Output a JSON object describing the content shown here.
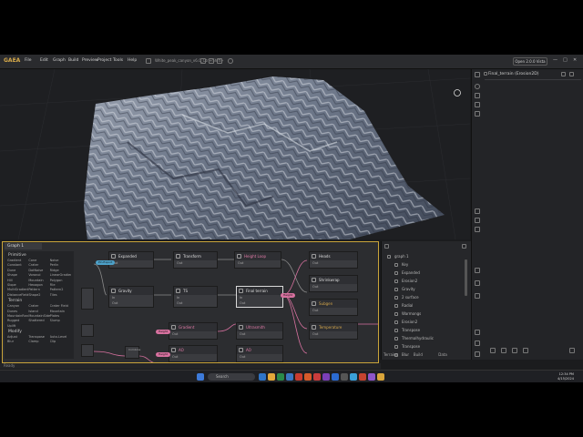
{
  "app": {
    "logo": "GAEA",
    "file_title": "White_peak_canyon_v6.0_Ctrl+Shift+",
    "open_button": "Open 2.0.0 Vista",
    "window_controls": [
      "—",
      "□",
      "✕"
    ]
  },
  "menu": [
    "File",
    "Edit",
    "Graph",
    "Build",
    "Preview",
    "Project",
    "Tools",
    "Help"
  ],
  "right_panel": {
    "title": "Final_terrain (Erosion2D)"
  },
  "graph": {
    "tab_label": "Graph 1",
    "palette": [
      {
        "title": "Primitive",
        "items": [
          "Gradient",
          "Cone",
          "Noise",
          "Constant",
          "Crater",
          "Perlin",
          "Dune",
          "DotNoise",
          "Ridge",
          "Shape",
          "Voronoi",
          "LinearGradient",
          "Hill",
          "Mountain",
          "Polygon",
          "Slope",
          "Hexagon",
          "File",
          "MultiGradient",
          "Pattern",
          "Pattern2",
          "DistanceField",
          "Shape2",
          "Tiles"
        ]
      },
      {
        "title": "Terrain",
        "items": [
          "Canyon",
          "Crater",
          "Crater Field",
          "Dunes",
          "Island",
          "Mountain",
          "MountainRange",
          "MountainSide",
          "Plates",
          "Rugged",
          "Shattered",
          "Slump",
          "Uplift"
        ]
      },
      {
        "title": "Modify",
        "items": [
          "Adjust",
          "Transpose",
          "Auto-Level",
          "Blur",
          "Clamp",
          "Clip"
        ]
      }
    ],
    "nodes": [
      {
        "title": "Expanded",
        "style": "normal",
        "rows": [
          "Out"
        ]
      },
      {
        "title": "Transform",
        "style": "normal",
        "rows": [
          "Out"
        ]
      },
      {
        "title": "Height Loop",
        "style": "pink",
        "rows": [
          "Out"
        ]
      },
      {
        "title": "Heads",
        "style": "normal",
        "rows": [
          "Out"
        ]
      },
      {
        "title": "Gravity",
        "style": "normal",
        "rows": [
          "In",
          "Out"
        ]
      },
      {
        "title": "TS",
        "style": "normal",
        "rows": [
          "In",
          "Out"
        ]
      },
      {
        "title": "Final terrain",
        "style": "normal",
        "rows": [
          "In",
          "Out"
        ]
      },
      {
        "title": "Shrinkwrap",
        "style": "normal",
        "rows": [
          "Out"
        ]
      },
      {
        "title": "Subgen",
        "style": "gold",
        "rows": [
          "Out"
        ]
      },
      {
        "title": "Gradient",
        "style": "pink",
        "rows": [
          "Out"
        ]
      },
      {
        "title": "Ultrasmith",
        "style": "pink",
        "rows": [
          "Out"
        ]
      },
      {
        "title": "Temperature",
        "style": "gold",
        "rows": [
          "Out"
        ]
      },
      {
        "title": "AO",
        "style": "pink",
        "rows": [
          "Out"
        ]
      },
      {
        "title": "AO",
        "style": "pink",
        "rows": [
          "Out"
        ]
      },
      {
        "title": "Combine",
        "style": "normal",
        "rows": [
          "Out"
        ]
      }
    ],
    "pill_labels": [
      "Pin Export",
      "Height",
      "Height",
      "Height"
    ]
  },
  "properties": {
    "tree": [
      "graph 1",
      "Key",
      "Expanded",
      "Erosion2",
      "Gravity",
      "2 surface",
      "Radial",
      "Warmongs",
      "Erosion2",
      "Transpose",
      "Thermalhydraulic",
      "Transpose",
      "Blur"
    ],
    "tabs": [
      "Terrains",
      "Build",
      "Data"
    ]
  },
  "bottom_status": "Ready",
  "taskbar": {
    "search_placeholder": "Search",
    "time": "12:34 PM",
    "date": "4/15/2024"
  },
  "colors": {
    "accent": "#c9a43a",
    "pink_wire": "#d7719f",
    "gold_text": "#d4a64a"
  }
}
